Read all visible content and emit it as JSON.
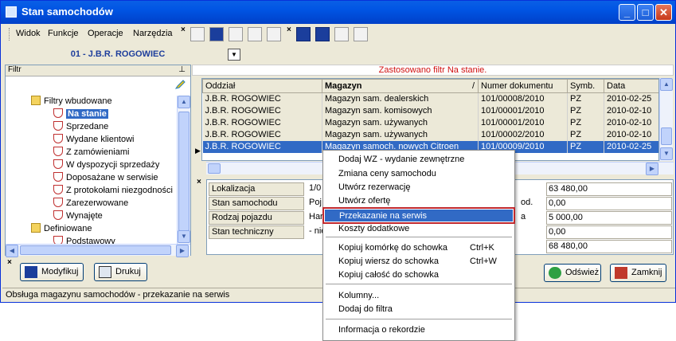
{
  "window": {
    "title": "Stan samochodów"
  },
  "menu": [
    "Widok",
    "Funkcje",
    "Operacje",
    "Narzędzia"
  ],
  "combo": {
    "value": "01 - J.B.R. ROGOWIEC"
  },
  "filter": {
    "header": "Filtr",
    "pin": "ᵖ",
    "tree": [
      {
        "label": "Filtry wbudowane",
        "type": "folder"
      },
      {
        "label": "Na stanie",
        "type": "filter",
        "selected": true
      },
      {
        "label": "Sprzedane",
        "type": "filter"
      },
      {
        "label": "Wydane klientowi",
        "type": "filter"
      },
      {
        "label": "Z zamówieniami",
        "type": "filter"
      },
      {
        "label": "W dyspozycji sprzedaży",
        "type": "filter"
      },
      {
        "label": "Doposażane w serwisie",
        "type": "filter"
      },
      {
        "label": "Z protokołami niezgodności",
        "type": "filter"
      },
      {
        "label": "Zarezerwowane",
        "type": "filter"
      },
      {
        "label": "Wynajęte",
        "type": "filter"
      },
      {
        "label": "Definiowane",
        "type": "folder"
      },
      {
        "label": "Podstawowy",
        "type": "filter"
      }
    ]
  },
  "grid": {
    "filter_notice": "Zastosowano filtr Na stanie.",
    "columns": [
      "Oddział",
      "Magazyn",
      "/",
      "Numer dokumentu",
      "Symb.",
      "Data"
    ],
    "rows": [
      [
        "J.B.R. ROGOWIEC",
        "Magazyn sam. dealerskich",
        "101/00008/2010",
        "PZ",
        "2010-02-25"
      ],
      [
        "J.B.R. ROGOWIEC",
        "Magazyn sam. komisowych",
        "101/00001/2010",
        "PZ",
        "2010-02-10"
      ],
      [
        "J.B.R. ROGOWIEC",
        "Magazyn sam. używanych",
        "101/00001/2010",
        "PZ",
        "2010-02-10"
      ],
      [
        "J.B.R. ROGOWIEC",
        "Magazyn sam. używanych",
        "101/00002/2010",
        "PZ",
        "2010-02-10"
      ],
      [
        "J.B.R. ROGOWIEC",
        "Magazyn samoch. nowych Citroen",
        "101/00009/2010",
        "PZ",
        "2010-02-25"
      ]
    ]
  },
  "details": [
    {
      "label": "Lokalizacja",
      "value": "1/0",
      "number": "63 480,00"
    },
    {
      "label": "Stan samochodu",
      "value": "Poj",
      "mid": "od.",
      "number": "0,00"
    },
    {
      "label": "Rodzaj pojazdu",
      "value": "Har",
      "mid": "a",
      "number": "5 000,00"
    },
    {
      "label": "Stan techniczny",
      "value": "- nie",
      "number": "0,00"
    },
    {
      "label": "",
      "value": "",
      "number": "68 480,00"
    }
  ],
  "buttons": {
    "modify": "Modyfikuj",
    "print": "Drukuj",
    "refresh": "Odśwież",
    "close": "Zamknij"
  },
  "status": "Obsługa magazynu samochodów - przekazanie na serwis",
  "context_menu": [
    {
      "label": "Dodaj WZ - wydanie zewnętrzne"
    },
    {
      "label": "Zmiana ceny samochodu"
    },
    {
      "label": "Utwórz rezerwację"
    },
    {
      "label": "Utwórz ofertę"
    },
    {
      "label": "Przekazanie na serwis",
      "highlight": true
    },
    {
      "label": "Koszty dodatkowe"
    },
    {
      "label": "Kopiuj komórkę do schowka",
      "shortcut": "Ctrl+K"
    },
    {
      "label": "Kopiuj wiersz do schowka",
      "shortcut": "Ctrl+W"
    },
    {
      "label": "Kopiuj całość do schowka"
    },
    {
      "label": "Kolumny..."
    },
    {
      "label": "Dodaj do filtra"
    },
    {
      "label": "Informacja o rekordzie"
    }
  ]
}
